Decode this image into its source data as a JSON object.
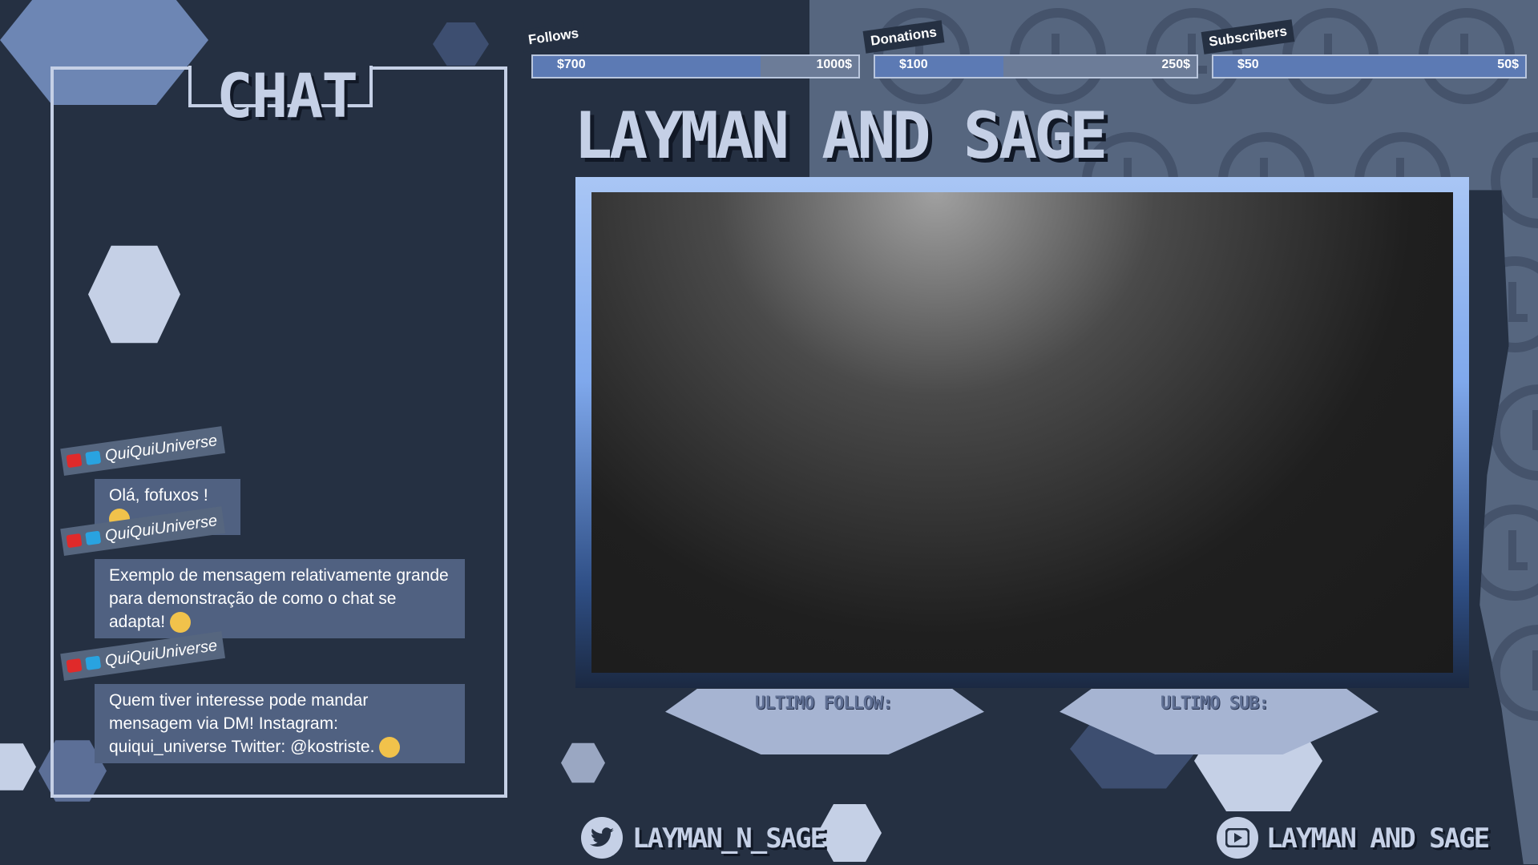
{
  "chat": {
    "title": "CHAT",
    "messages": [
      {
        "user": "QuiQuiUniverse",
        "text": "Olá, fofuxos !"
      },
      {
        "user": "QuiQuiUniverse",
        "text": "Exemplo de mensagem relativamente grande para demonstração de como o chat se adapta!"
      },
      {
        "user": "QuiQuiUniverse",
        "text": "Quem tiver interesse pode mandar mensagem via DM! Instagram: quiqui_universe Twitter: @kostriste."
      }
    ]
  },
  "goals": [
    {
      "label": "Follows",
      "current": "$700",
      "target": "1000$",
      "progress": 0.7
    },
    {
      "label": "Donations",
      "current": "$100",
      "target": "250$",
      "progress": 0.4
    },
    {
      "label": "Subscribers",
      "current": "$50",
      "target": "50$",
      "progress": 1.0
    }
  ],
  "stream_title": "LAYMAN AND SAGE",
  "last_follow_label": "ULTIMO FOLLOW:",
  "last_sub_label": "ULTIMO SUB:",
  "social": {
    "twitter_handle": "LAYMAN_N_SAGE",
    "youtube_handle": "LAYMAN AND SAGE"
  },
  "colors": {
    "background": "#253042",
    "accent_light": "#c5d0e6",
    "panel": "#506181",
    "pattern": "#56667f"
  }
}
